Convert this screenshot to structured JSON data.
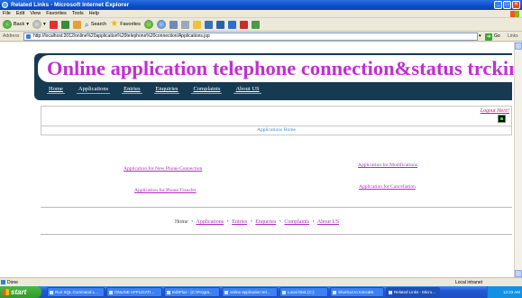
{
  "window": {
    "title": "Related Links - Microsoft Internet Explorer",
    "buttons": [
      "_",
      "□",
      "×"
    ]
  },
  "menu": [
    "File",
    "Edit",
    "View",
    "Favorites",
    "Tools",
    "Help"
  ],
  "toolbar": {
    "back_label": "Back",
    "search_label": "Search",
    "favorites_label": "Favorites"
  },
  "address": {
    "label": "Address",
    "url": "http://localhost:2012/online%20application%20telephone%20connection/Applications.jsp",
    "go_label": "Go",
    "links_label": "Links"
  },
  "site": {
    "title": "Online application telephone connection&status trcking s",
    "nav": [
      "Home",
      "Applications",
      "Entries",
      "Enquiries",
      "Complaints",
      "About US"
    ],
    "active_nav": "Applications",
    "logout_label": "Logout Here!",
    "panel_link": "Applications Home"
  },
  "applications": {
    "new_connection": "Application for New Phone Connection",
    "modifications": "Application for Modifications",
    "phone_transfer": "Application for Phone Transfer",
    "cancellation": "Application for Cancellation"
  },
  "footer": {
    "items": [
      "Home",
      "Applications",
      "Entries",
      "Enquiries",
      "Complaints",
      "About US"
    ],
    "separator": "•"
  },
  "status": {
    "text": "Done",
    "zone": "Local intranet"
  },
  "taskbar": {
    "start_label": "start",
    "tasks": [
      "Run SQL Command L...",
      "ONLINE APPLICATI...",
      "EditPlus - [C:\\Progra...",
      "online application tel...",
      "Local Disk (C:)",
      "Shortcut to tomcat6",
      "Related Links - Micro..."
    ],
    "active_task": "Related Links - Micro...",
    "clock": "12:23 AM"
  }
}
